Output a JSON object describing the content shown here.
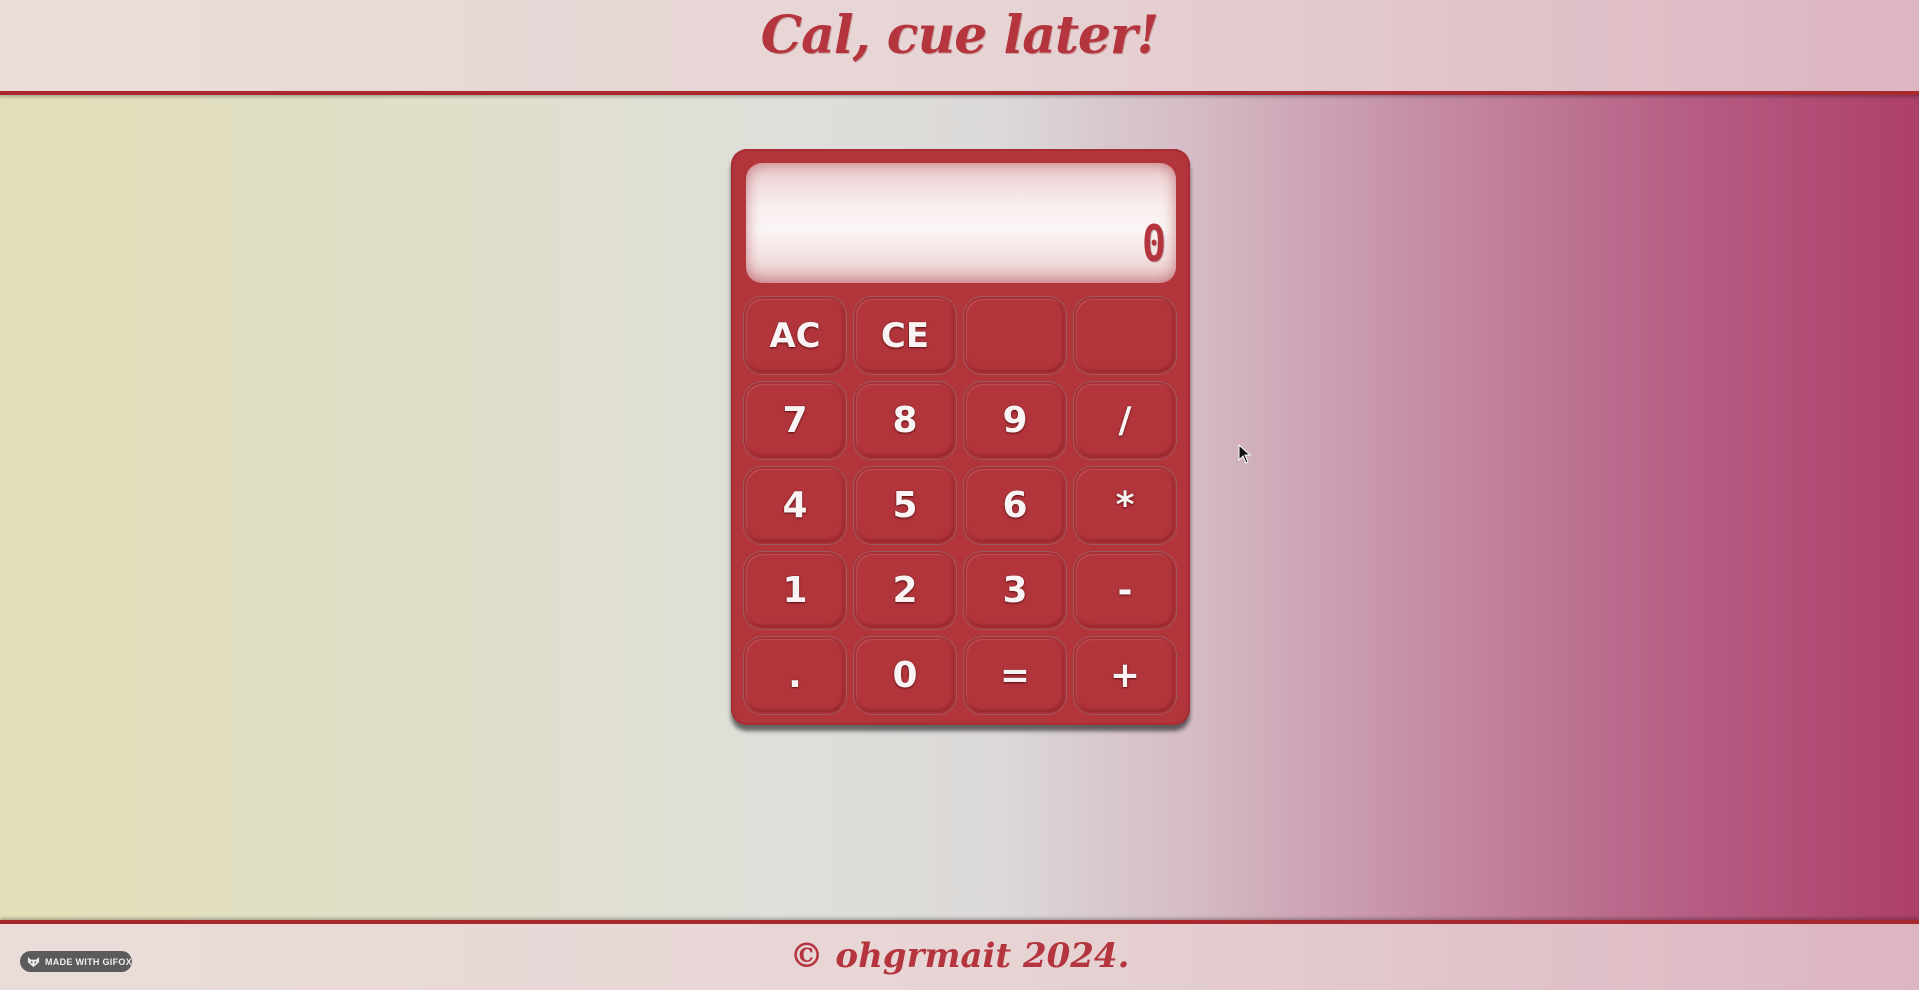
{
  "header": {
    "title": "Cal, cue later!"
  },
  "calculator": {
    "display_value": "0",
    "keys": [
      {
        "label": "AC",
        "name": "all-clear-button"
      },
      {
        "label": "CE",
        "name": "clear-entry-button"
      },
      {
        "label": "",
        "name": "blank-button-1"
      },
      {
        "label": "",
        "name": "blank-button-2"
      },
      {
        "label": "7",
        "name": "digit-7-button"
      },
      {
        "label": "8",
        "name": "digit-8-button"
      },
      {
        "label": "9",
        "name": "digit-9-button"
      },
      {
        "label": "/",
        "name": "divide-button"
      },
      {
        "label": "4",
        "name": "digit-4-button"
      },
      {
        "label": "5",
        "name": "digit-5-button"
      },
      {
        "label": "6",
        "name": "digit-6-button"
      },
      {
        "label": "*",
        "name": "multiply-button"
      },
      {
        "label": "1",
        "name": "digit-1-button"
      },
      {
        "label": "2",
        "name": "digit-2-button"
      },
      {
        "label": "3",
        "name": "digit-3-button"
      },
      {
        "label": "-",
        "name": "subtract-button"
      },
      {
        "label": ".",
        "name": "decimal-button"
      },
      {
        "label": "0",
        "name": "digit-0-button"
      },
      {
        "label": "=",
        "name": "equals-button"
      },
      {
        "label": "+",
        "name": "add-button"
      }
    ]
  },
  "footer": {
    "copyright": "© ohgrmait 2024.",
    "badge_label": "MADE WITH GIFOX"
  },
  "colors": {
    "accent": "#b3353c",
    "display_bg": "#fbf5f5",
    "key_text": "#faf3f3"
  }
}
